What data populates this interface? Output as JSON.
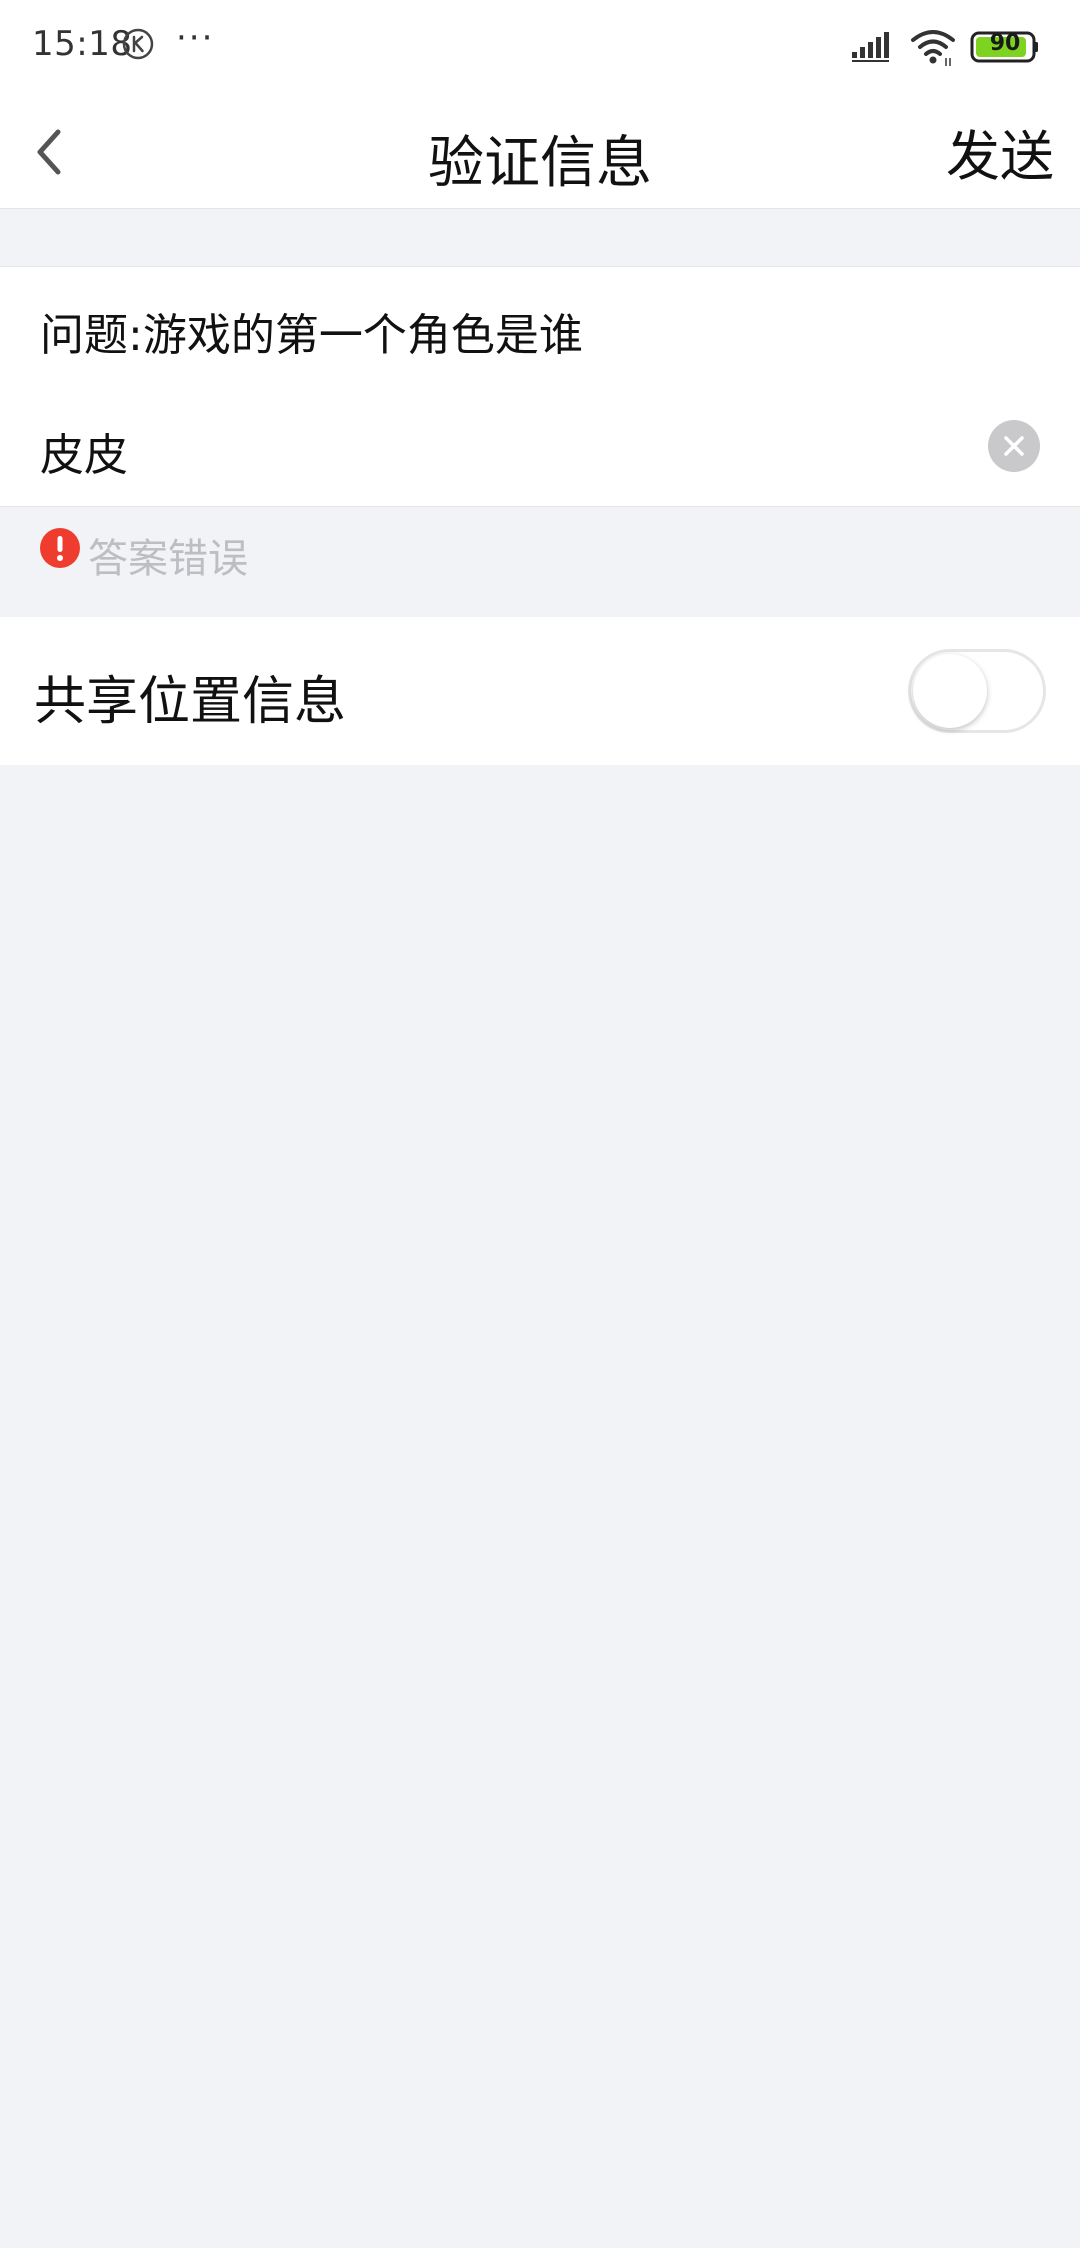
{
  "status_bar": {
    "time": "15:18",
    "k_icon": "k-circle-icon",
    "more": "···",
    "battery_level": "90",
    "colors": {
      "battery_fill": "#7ed321"
    }
  },
  "nav": {
    "back_icon": "chevron-left-icon",
    "title": "验证信息",
    "send_label": "发送"
  },
  "form": {
    "question": "问题:游戏的第一个角色是谁",
    "answer_value": "皮皮",
    "clear_icon": "clear-circle-icon",
    "error": {
      "icon": "exclamation-circle-icon",
      "text": "答案错误",
      "color": "#ee3d2f"
    }
  },
  "location": {
    "label": "共享位置信息",
    "enabled": false
  },
  "colors": {
    "page_bg": "#f2f3f7",
    "card_bg": "#ffffff",
    "error_red": "#ee3d2f",
    "hint_gray": "#bdbdc2"
  }
}
